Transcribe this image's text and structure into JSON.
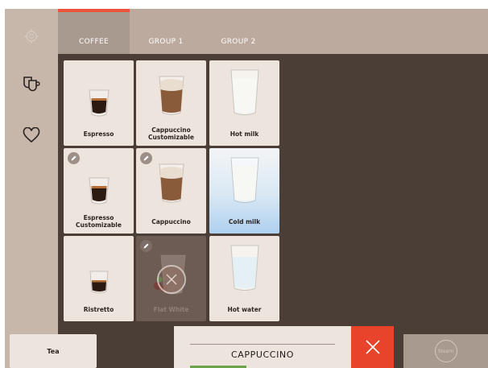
{
  "tabs": [
    {
      "label": "COFFEE",
      "active": true
    },
    {
      "label": "GROUP 1",
      "active": false
    },
    {
      "label": "GROUP 2",
      "active": false
    }
  ],
  "sidebar": {
    "icons": [
      "settings-gear-icon",
      "cups-icon",
      "heart-icon"
    ]
  },
  "products": [
    {
      "label": "Espresso",
      "drink": "espresso",
      "editable": false,
      "state": "normal"
    },
    {
      "label": "Cappuccino Customizable",
      "drink": "cappuccino",
      "editable": false,
      "state": "normal"
    },
    {
      "label": "Hot milk",
      "drink": "milk",
      "editable": false,
      "state": "normal"
    },
    {
      "label": "Espresso Customizable",
      "drink": "espresso",
      "editable": true,
      "state": "normal"
    },
    {
      "label": "Cappuccino",
      "drink": "cappuccino",
      "editable": true,
      "state": "normal"
    },
    {
      "label": "Cold milk",
      "drink": "milk",
      "editable": false,
      "state": "selected"
    },
    {
      "label": "Ristretto",
      "drink": "ristretto",
      "editable": false,
      "state": "normal"
    },
    {
      "label": "Flat White",
      "drink": "flatwhite",
      "editable": true,
      "state": "disabled"
    },
    {
      "label": "Hot water",
      "drink": "water",
      "editable": false,
      "state": "normal"
    }
  ],
  "bottom": {
    "tea_label": "Tea",
    "order_name": "CAPPUCCINO",
    "steam_label": "Steam"
  },
  "colors": {
    "accent": "#e8442b",
    "background": "#4a3e37",
    "sidebar": "#c7b7ab",
    "tile": "#ede4dd",
    "selected_tile": "#aed0ef"
  }
}
